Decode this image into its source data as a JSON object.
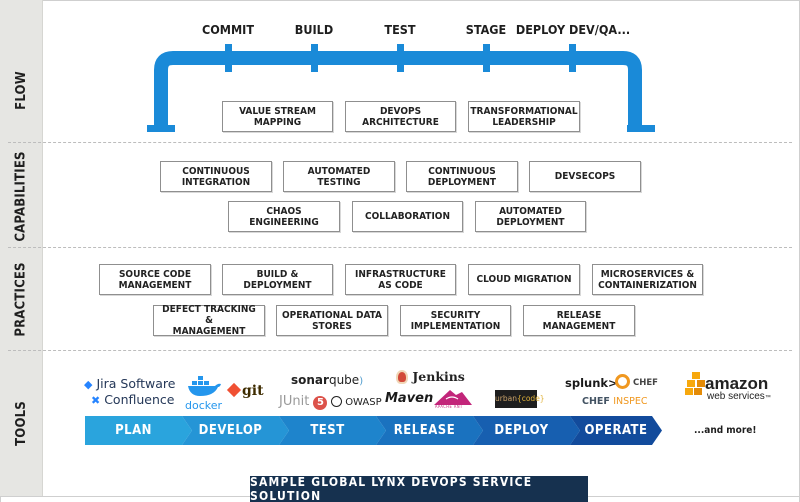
{
  "sections": {
    "flow": "FLOW",
    "capabilities": "CAPABILITIES",
    "practices": "PRACTICES",
    "tools": "TOOLS"
  },
  "flow": {
    "pipeline_color": "#1a8ad8",
    "stages": [
      "COMMIT",
      "BUILD",
      "TEST",
      "STAGE",
      "DEPLOY DEV/QA..."
    ],
    "boxes": [
      [
        "VALUE STREAM",
        "MAPPING"
      ],
      [
        "DEVOPS",
        "ARCHITECTURE"
      ],
      [
        "TRANSFORMATIONAL",
        "LEADERSHIP"
      ]
    ]
  },
  "capabilities": {
    "row1": [
      [
        "CONTINUOUS",
        "INTEGRATION"
      ],
      [
        "AUTOMATED",
        "TESTING"
      ],
      [
        "CONTINUOUS",
        "DEPLOYMENT"
      ],
      [
        "DEVSECOPS"
      ]
    ],
    "row2": [
      [
        "CHAOS ENGINEERING"
      ],
      [
        "COLLABORATION"
      ],
      [
        "AUTOMATED",
        "DEPLOYMENT"
      ]
    ]
  },
  "practices": {
    "row1": [
      [
        "SOURCE CODE",
        "MANAGEMENT"
      ],
      [
        "BUILD &",
        "DEPLOYMENT"
      ],
      [
        "INFRASTRUCTURE",
        "AS CODE"
      ],
      [
        "CLOUD MIGRATION"
      ],
      [
        "MICROSERVICES &",
        "CONTAINERIZATION"
      ]
    ],
    "row2": [
      [
        "DEFECT TRACKING &",
        "MANAGEMENT"
      ],
      [
        "OPERATIONAL DATA",
        "STORES"
      ],
      [
        "SECURITY",
        "IMPLEMENTATION"
      ],
      [
        "RELEASE",
        "MANAGEMENT"
      ]
    ]
  },
  "tools": {
    "logos": {
      "jira": "Jira Software",
      "confluence": "Confluence",
      "docker": "docker",
      "git": "git",
      "sonarqube_a": "sonar",
      "sonarqube_b": "qube",
      "junit": "JUnit",
      "junit_version": "5",
      "owasp": "OWASP",
      "jenkins": "Jenkins",
      "maven": "Maven",
      "ant": "APACHE ANT",
      "urbancode_a": "urban",
      "urbancode_b": "{code}",
      "splunk": "splunk>",
      "chef": "CHEF",
      "chef_inspec_a": "CHEF",
      "chef_inspec_b": "INSPEC",
      "amazon": "amazon",
      "aws": "web services",
      "tm": "™"
    },
    "stages": [
      {
        "label": "PLAN",
        "color": "#2aa4dd"
      },
      {
        "label": "DEVELOP",
        "color": "#2595d6"
      },
      {
        "label": "TEST",
        "color": "#1e84cc"
      },
      {
        "label": "RELEASE",
        "color": "#1a72bf"
      },
      {
        "label": "DEPLOY",
        "color": "#175fb0"
      },
      {
        "label": "OPERATE",
        "color": "#124b9c"
      }
    ],
    "more": "...and more!"
  },
  "caption": "SAMPLE GLOBAL LYNX DEVOPS SERVICE SOLUTION"
}
